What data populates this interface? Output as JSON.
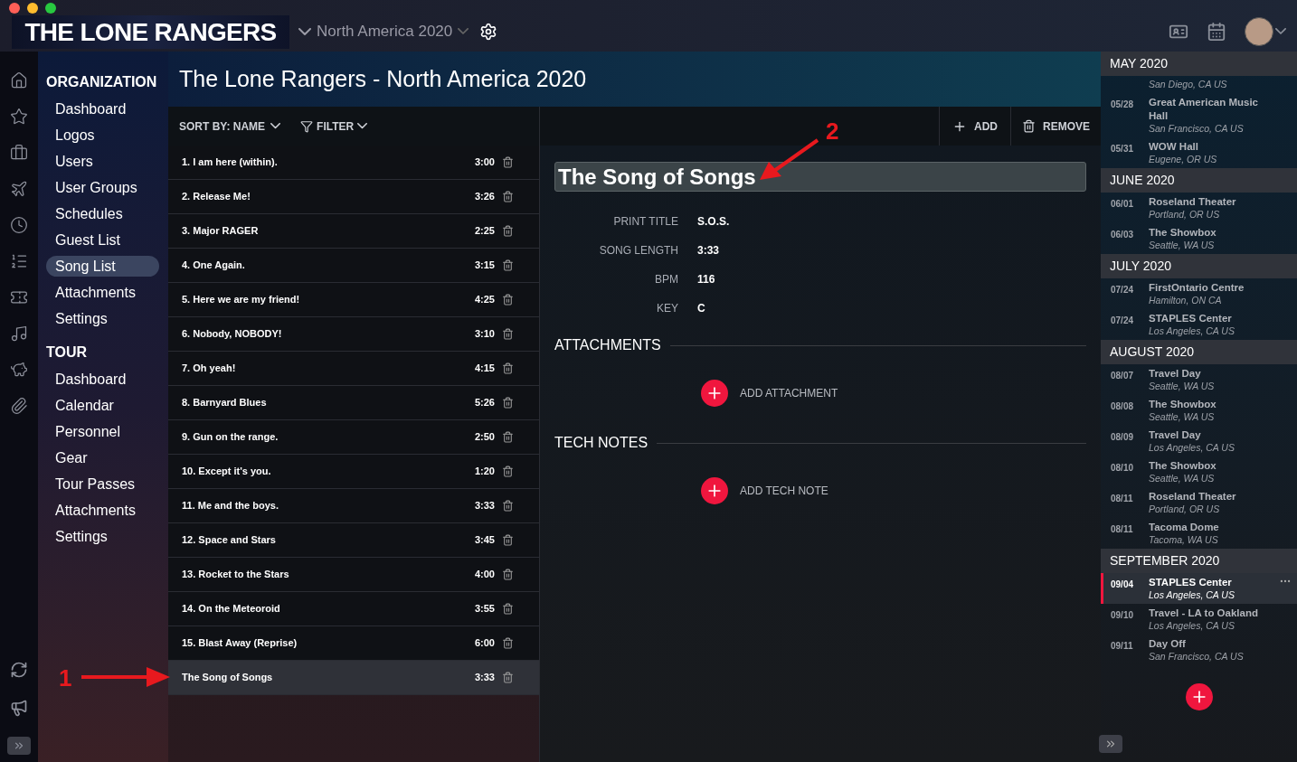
{
  "topbar": {
    "logo": "THE LONE RANGERS",
    "tour_selector": "North America 2020"
  },
  "rail_icons": [
    {
      "kind": "home",
      "selected": false
    },
    {
      "kind": "star",
      "selected": false
    },
    {
      "kind": "briefcase",
      "selected": false
    },
    {
      "kind": "plane",
      "selected": false
    },
    {
      "kind": "clock",
      "selected": false
    },
    {
      "kind": "list",
      "selected": false
    },
    {
      "kind": "ticket",
      "selected": false
    },
    {
      "kind": "music",
      "selected": false
    },
    {
      "kind": "piggy",
      "selected": false
    },
    {
      "kind": "clip",
      "selected": false
    }
  ],
  "nav": [
    {
      "heading": "ORGANIZATION",
      "items": [
        {
          "label": "Dashboard",
          "selected": false
        },
        {
          "label": "Logos",
          "selected": false
        },
        {
          "label": "Users",
          "selected": false
        },
        {
          "label": "User Groups",
          "selected": false
        },
        {
          "label": "Schedules",
          "selected": false
        },
        {
          "label": "Guest List",
          "selected": false
        },
        {
          "label": "Song List",
          "selected": true
        },
        {
          "label": "Attachments",
          "selected": false
        },
        {
          "label": "Settings",
          "selected": false
        }
      ]
    },
    {
      "heading": "TOUR",
      "items": [
        {
          "label": "Dashboard",
          "selected": false
        },
        {
          "label": "Calendar",
          "selected": false
        },
        {
          "label": "Personnel",
          "selected": false
        },
        {
          "label": "Gear",
          "selected": false
        },
        {
          "label": "Tour Passes",
          "selected": false
        },
        {
          "label": "Attachments",
          "selected": false
        },
        {
          "label": "Settings",
          "selected": false
        }
      ]
    }
  ],
  "page_title": "The Lone Rangers - North America 2020",
  "toolbar": {
    "sort": "SORT BY: NAME",
    "filter": "FILTER",
    "add": "ADD",
    "remove": "REMOVE"
  },
  "songs": [
    {
      "title": "1. I am here (within).",
      "length": "3:00",
      "selected": false
    },
    {
      "title": "2. Release Me!",
      "length": "3:26",
      "selected": false
    },
    {
      "title": "3. Major RAGER",
      "length": "2:25",
      "selected": false
    },
    {
      "title": "4. One Again.",
      "length": "3:15",
      "selected": false
    },
    {
      "title": "5. Here we are my friend!",
      "length": "4:25",
      "selected": false
    },
    {
      "title": "6. Nobody, NOBODY!",
      "length": "3:10",
      "selected": false
    },
    {
      "title": "7. Oh yeah!",
      "length": "4:15",
      "selected": false
    },
    {
      "title": "8. Barnyard Blues",
      "length": "5:26",
      "selected": false
    },
    {
      "title": "9. Gun on the range.",
      "length": "2:50",
      "selected": false
    },
    {
      "title": "10. Except it's you.",
      "length": "1:20",
      "selected": false
    },
    {
      "title": "11. Me and the boys.",
      "length": "3:33",
      "selected": false
    },
    {
      "title": "12. Space and Stars",
      "length": "3:45",
      "selected": false
    },
    {
      "title": "13. Rocket to the Stars",
      "length": "4:00",
      "selected": false
    },
    {
      "title": "14. On the Meteoroid",
      "length": "3:55",
      "selected": false
    },
    {
      "title": "15. Blast Away (Reprise)",
      "length": "6:00",
      "selected": false
    },
    {
      "title": "The Song of Songs",
      "length": "3:33",
      "selected": true
    }
  ],
  "detail": {
    "title_value": "The Song of Songs",
    "fields": [
      {
        "label": "PRINT TITLE",
        "value": "S.O.S."
      },
      {
        "label": "SONG LENGTH",
        "value": "3:33"
      },
      {
        "label": "BPM",
        "value": "116"
      },
      {
        "label": "KEY",
        "value": "C"
      }
    ],
    "sections": [
      {
        "heading": "ATTACHMENTS",
        "action": "ADD ATTACHMENT"
      },
      {
        "heading": "TECH NOTES",
        "action": "ADD TECH NOTE"
      }
    ]
  },
  "events": [
    {
      "month": "MAY 2020",
      "items": [
        {
          "location": "San Diego, CA US",
          "selected": false
        },
        {
          "date": "05/28",
          "venue": "Great American Music Hall",
          "location": "San Francisco, CA US",
          "selected": false
        },
        {
          "date": "05/31",
          "venue": "WOW Hall",
          "location": "Eugene, OR US",
          "selected": false
        }
      ]
    },
    {
      "month": "JUNE 2020",
      "items": [
        {
          "date": "06/01",
          "venue": "Roseland Theater",
          "location": "Portland, OR US",
          "selected": false
        },
        {
          "date": "06/03",
          "venue": "The Showbox",
          "location": "Seattle, WA US",
          "selected": false
        }
      ]
    },
    {
      "month": "JULY 2020",
      "items": [
        {
          "date": "07/24",
          "venue": "FirstOntario Centre",
          "location": "Hamilton, ON CA",
          "selected": false
        },
        {
          "date": "07/24",
          "venue": "STAPLES Center",
          "location": "Los Angeles, CA US",
          "selected": false
        }
      ]
    },
    {
      "month": "AUGUST 2020",
      "items": [
        {
          "date": "08/07",
          "venue": "Travel Day",
          "location": "Seattle, WA US",
          "selected": false
        },
        {
          "date": "08/08",
          "venue": "The Showbox",
          "location": "Seattle, WA US",
          "selected": false
        },
        {
          "date": "08/09",
          "venue": "Travel Day",
          "location": "Los Angeles, CA US",
          "selected": false
        },
        {
          "date": "08/10",
          "venue": "The Showbox",
          "location": "Seattle, WA US",
          "selected": false
        },
        {
          "date": "08/11",
          "venue": "Roseland Theater",
          "location": "Portland, OR US",
          "selected": false
        },
        {
          "date": "08/11",
          "venue": "Tacoma Dome",
          "location": "Tacoma, WA US",
          "selected": false
        }
      ]
    },
    {
      "month": "SEPTEMBER 2020",
      "items": [
        {
          "date": "09/04",
          "venue": "STAPLES Center",
          "location": "Los Angeles, CA US",
          "selected": true
        },
        {
          "date": "09/10",
          "venue": "Travel - LA to Oakland",
          "location": "Los Angeles, CA US",
          "selected": false
        },
        {
          "date": "09/11",
          "venue": "Day Off",
          "location": "San Francisco, CA US",
          "selected": false
        }
      ]
    }
  ],
  "annotations": [
    {
      "label": "1"
    },
    {
      "label": "2"
    }
  ]
}
